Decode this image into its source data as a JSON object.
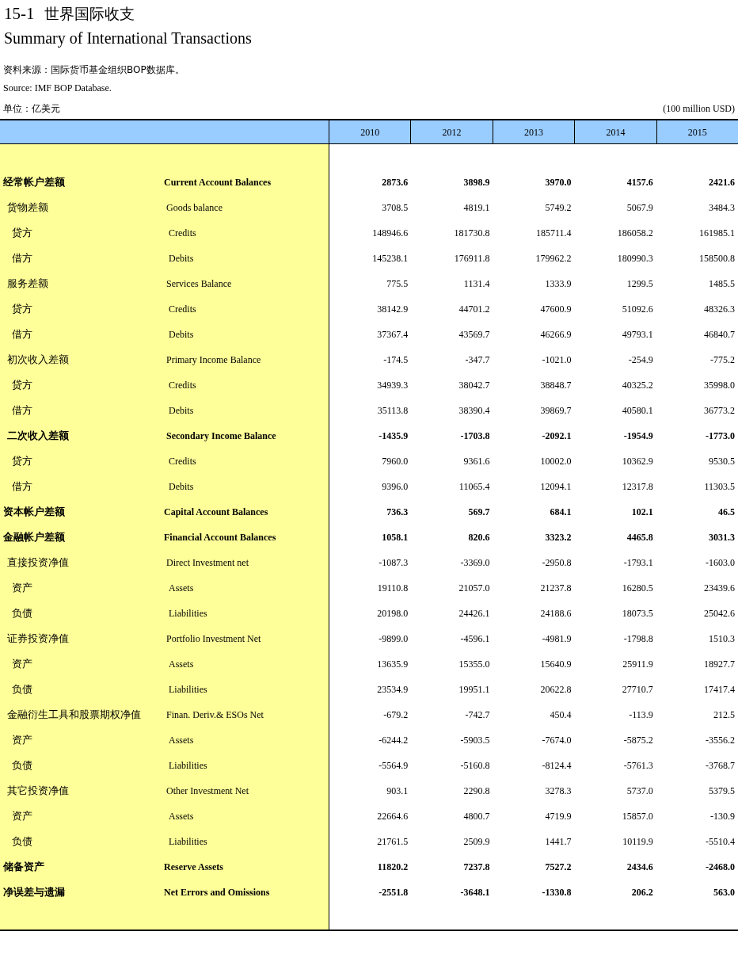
{
  "title": {
    "number": "15-1",
    "zh": "世界国际收支",
    "en": "Summary of International Transactions"
  },
  "source_zh": "资料来源：国际货币基金组织BOP数据库。",
  "source_en": "Source: IMF BOP Database.",
  "unit_zh": "单位：亿美元",
  "unit_en": "(100 million USD)",
  "table": {
    "columns": [
      "2010",
      "2012",
      "2013",
      "2014",
      "2015"
    ],
    "rows": [
      {
        "zh": "经常帐户差额",
        "en": "Current Account Balances",
        "bold": true,
        "values": [
          "2873.6",
          "3898.9",
          "3970.0",
          "4157.6",
          "2421.6"
        ],
        "children": [
          {
            "zh": "货物差额",
            "en": "Goods balance",
            "bold": false,
            "values": [
              "3708.5",
              "4819.1",
              "5749.2",
              "5067.9",
              "3484.3"
            ],
            "children": [
              {
                "zh": "贷方",
                "en": "Credits",
                "bold": false,
                "values": [
                  "148946.6",
                  "181730.8",
                  "185711.4",
                  "186058.2",
                  "161985.1"
                ]
              },
              {
                "zh": "借方",
                "en": "Debits",
                "bold": false,
                "values": [
                  "145238.1",
                  "176911.8",
                  "179962.2",
                  "180990.3",
                  "158500.8"
                ]
              }
            ]
          },
          {
            "zh": "服务差额",
            "en": "Services Balance",
            "bold": false,
            "values": [
              "775.5",
              "1131.4",
              "1333.9",
              "1299.5",
              "1485.5"
            ],
            "children": [
              {
                "zh": "贷方",
                "en": "Credits",
                "bold": false,
                "values": [
                  "38142.9",
                  "44701.2",
                  "47600.9",
                  "51092.6",
                  "48326.3"
                ]
              },
              {
                "zh": "借方",
                "en": "Debits",
                "bold": false,
                "values": [
                  "37367.4",
                  "43569.7",
                  "46266.9",
                  "49793.1",
                  "46840.7"
                ]
              }
            ]
          },
          {
            "zh": "初次收入差额",
            "en": "Primary Income Balance",
            "bold": false,
            "values": [
              "-174.5",
              "-347.7",
              "-1021.0",
              "-254.9",
              "-775.2"
            ],
            "children": [
              {
                "zh": "贷方",
                "en": "Credits",
                "bold": false,
                "values": [
                  "34939.3",
                  "38042.7",
                  "38848.7",
                  "40325.2",
                  "35998.0"
                ]
              },
              {
                "zh": "借方",
                "en": "Debits",
                "bold": false,
                "values": [
                  "35113.8",
                  "38390.4",
                  "39869.7",
                  "40580.1",
                  "36773.2"
                ]
              }
            ]
          },
          {
            "zh": "二次收入差额",
            "en": "Secondary Income Balance",
            "bold": true,
            "values": [
              "-1435.9",
              "-1703.8",
              "-2092.1",
              "-1954.9",
              "-1773.0"
            ],
            "children": [
              {
                "zh": "贷方",
                "en": "Credits",
                "bold": false,
                "values": [
                  "7960.0",
                  "9361.6",
                  "10002.0",
                  "10362.9",
                  "9530.5"
                ]
              },
              {
                "zh": "借方",
                "en": "Debits",
                "bold": false,
                "values": [
                  "9396.0",
                  "11065.4",
                  "12094.1",
                  "12317.8",
                  "11303.5"
                ]
              }
            ]
          }
        ]
      },
      {
        "zh": "资本帐户差额",
        "en": "Capital Account Balances",
        "bold": true,
        "values": [
          "736.3",
          "569.7",
          "684.1",
          "102.1",
          "46.5"
        ]
      },
      {
        "zh": "金融帐户差额",
        "en": "Financial Account Balances",
        "bold": true,
        "values": [
          "1058.1",
          "820.6",
          "3323.2",
          "4465.8",
          "3031.3"
        ],
        "children": [
          {
            "zh": "直接投资净值",
            "en": "Direct Investment net",
            "bold": false,
            "values": [
              "-1087.3",
              "-3369.0",
              "-2950.8",
              "-1793.1",
              "-1603.0"
            ],
            "children": [
              {
                "zh": "资产",
                "en": "Assets",
                "bold": false,
                "values": [
                  "19110.8",
                  "21057.0",
                  "21237.8",
                  "16280.5",
                  "23439.6"
                ]
              },
              {
                "zh": "负债",
                "en": "Liabilities",
                "bold": false,
                "values": [
                  "20198.0",
                  "24426.1",
                  "24188.6",
                  "18073.5",
                  "25042.6"
                ]
              }
            ]
          },
          {
            "zh": "证券投资净值",
            "en": "Portfolio Investment Net",
            "bold": false,
            "values": [
              "-9899.0",
              "-4596.1",
              "-4981.9",
              "-1798.8",
              "1510.3"
            ],
            "children": [
              {
                "zh": "资产",
                "en": "Assets",
                "bold": false,
                "values": [
                  "13635.9",
                  "15355.0",
                  "15640.9",
                  "25911.9",
                  "18927.7"
                ]
              },
              {
                "zh": "负债",
                "en": "Liabilities",
                "bold": false,
                "values": [
                  "23534.9",
                  "19951.1",
                  "20622.8",
                  "27710.7",
                  "17417.4"
                ]
              }
            ]
          },
          {
            "zh": "金融衍生工具和股票期权净值",
            "en": "Finan. Deriv.& ESOs Net",
            "bold": false,
            "values": [
              "-679.2",
              "-742.7",
              "450.4",
              "-113.9",
              "212.5"
            ],
            "children": [
              {
                "zh": "资产",
                "en": "Assets",
                "bold": false,
                "values": [
                  "-6244.2",
                  "-5903.5",
                  "-7674.0",
                  "-5875.2",
                  "-3556.2"
                ]
              },
              {
                "zh": "负债",
                "en": "Liabilities",
                "bold": false,
                "values": [
                  "-5564.9",
                  "-5160.8",
                  "-8124.4",
                  "-5761.3",
                  "-3768.7"
                ]
              }
            ]
          },
          {
            "zh": "其它投资净值",
            "en": "Other Investment Net",
            "bold": false,
            "values": [
              "903.1",
              "2290.8",
              "3278.3",
              "5737.0",
              "5379.5"
            ],
            "children": [
              {
                "zh": "资产",
                "en": "Assets",
                "bold": false,
                "values": [
                  "22664.6",
                  "4800.7",
                  "4719.9",
                  "15857.0",
                  "-130.9"
                ]
              },
              {
                "zh": "负债",
                "en": "Liabilities",
                "bold": false,
                "values": [
                  "21761.5",
                  "2509.9",
                  "1441.7",
                  "10119.9",
                  "-5510.4"
                ]
              }
            ]
          }
        ]
      },
      {
        "zh": "储备资产",
        "en": "Reserve Assets",
        "bold": true,
        "values": [
          "11820.2",
          "7237.8",
          "7527.2",
          "2434.6",
          "-2468.0"
        ]
      },
      {
        "zh": "净误差与遗漏",
        "en": "Net Errors and Omissions",
        "bold": true,
        "values": [
          "-2551.8",
          "-3648.1",
          "-1330.8",
          "206.2",
          "563.0"
        ]
      }
    ]
  }
}
